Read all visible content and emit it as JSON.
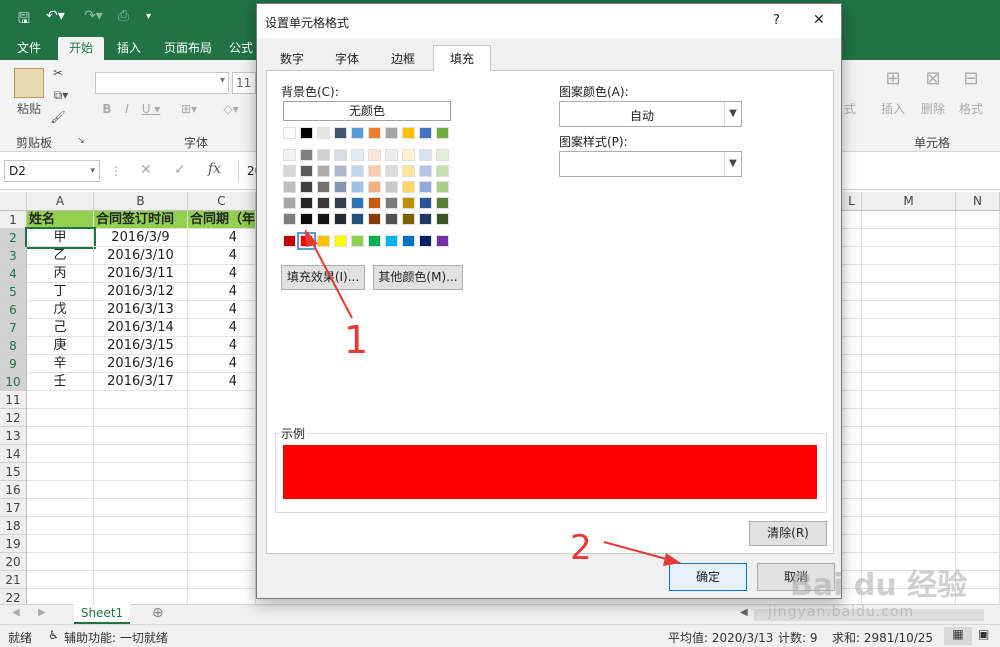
{
  "colors": {
    "excel_green": "#217346",
    "header_fill": "#92d050",
    "sample_red": "#ff0000",
    "annotation_red": "#e53935"
  },
  "excel": {
    "ribbon_tabs": [
      "文件",
      "开始",
      "插入",
      "页面布局",
      "公式"
    ],
    "active_tab": "开始",
    "groups": {
      "clipboard": "剪贴板",
      "font": "字体",
      "cells": "单元格"
    },
    "clipboard": {
      "paste": "粘贴"
    },
    "font_size_partial": "11",
    "cells_buttons": {
      "insert": "插入",
      "delete": "删除",
      "format": "格式",
      "styles_partial": "式"
    },
    "name_box": "D2",
    "formula_icon": "fx",
    "formula_partial": "20",
    "col_headers": [
      "A",
      "B",
      "C",
      "L",
      "M",
      "N"
    ],
    "rows": [
      "1",
      "2",
      "3",
      "4",
      "5",
      "6",
      "7",
      "8",
      "9",
      "10",
      "11",
      "12",
      "13",
      "14",
      "15",
      "16",
      "17",
      "18",
      "19",
      "20",
      "21",
      "22"
    ],
    "header_row": {
      "a": "姓名",
      "b": "合同签订时间",
      "c": "合同期（年"
    },
    "data": [
      {
        "a": "甲",
        "b": "2016/3/9",
        "c": "4"
      },
      {
        "a": "乙",
        "b": "2016/3/10",
        "c": "4"
      },
      {
        "a": "丙",
        "b": "2016/3/11",
        "c": "4"
      },
      {
        "a": "丁",
        "b": "2016/3/12",
        "c": "4"
      },
      {
        "a": "戊",
        "b": "2016/3/13",
        "c": "4"
      },
      {
        "a": "己",
        "b": "2016/3/14",
        "c": "4"
      },
      {
        "a": "庚",
        "b": "2016/3/15",
        "c": "4"
      },
      {
        "a": "辛",
        "b": "2016/3/16",
        "c": "4"
      },
      {
        "a": "壬",
        "b": "2016/3/17",
        "c": "4"
      }
    ],
    "sheet_tab": "Sheet1",
    "status": {
      "ready": "就绪",
      "accessibility": "辅助功能: 一切就绪",
      "average": "平均值: 2020/3/13",
      "count": "计数: 9",
      "sum": "求和: 2981/10/25"
    }
  },
  "dialog": {
    "title": "设置单元格格式",
    "help": "?",
    "close": "✕",
    "tabs": [
      "数字",
      "字体",
      "边框",
      "填充"
    ],
    "active_tab": "填充",
    "bg_color_label": "背景色(C):",
    "no_color": "无颜色",
    "theme_row": [
      "#ffffff",
      "#000000",
      "#e7e6e6",
      "#44546a",
      "#5b9bd5",
      "#ed7d31",
      "#a5a5a5",
      "#ffc000",
      "#4472c4",
      "#70ad47"
    ],
    "tint_rows": [
      [
        "#f2f2f2",
        "#7f7f7f",
        "#d0cece",
        "#d6dce4",
        "#deebf6",
        "#fbe5d5",
        "#ededed",
        "#fff2cc",
        "#d9e2f3",
        "#e2efd9"
      ],
      [
        "#d8d8d8",
        "#595959",
        "#aeabab",
        "#adb9ca",
        "#bdd7ee",
        "#f7cbac",
        "#dbdbdb",
        "#fee599",
        "#b4c6e7",
        "#c5e0b3"
      ],
      [
        "#bfbfbf",
        "#3f3f3f",
        "#757070",
        "#8496b0",
        "#9dc3e6",
        "#f4b183",
        "#c9c9c9",
        "#ffd965",
        "#8eaadb",
        "#a8d08d"
      ],
      [
        "#a5a5a5",
        "#262626",
        "#3a3838",
        "#323f4f",
        "#2e75b5",
        "#c55a11",
        "#7b7b7b",
        "#bf9000",
        "#2f5496",
        "#538135"
      ],
      [
        "#7f7f7f",
        "#0c0c0c",
        "#171616",
        "#222a35",
        "#1e4e79",
        "#843c0b",
        "#525252",
        "#7f6000",
        "#1f3864",
        "#375623"
      ]
    ],
    "standard_row": [
      "#c00000",
      "#ff0000",
      "#ffc000",
      "#ffff00",
      "#92d050",
      "#00b050",
      "#00b0f0",
      "#0070c0",
      "#002060",
      "#7030a0"
    ],
    "selected_standard_index": 1,
    "fill_effects": "填充效果(I)...",
    "more_colors": "其他颜色(M)...",
    "pattern_color_label": "图案颜色(A):",
    "pattern_color_value": "自动",
    "pattern_style_label": "图案样式(P):",
    "sample_label": "示例",
    "sample_color": "#ff0000",
    "clear": "清除(R)",
    "ok": "确定",
    "cancel_partial": "取消"
  },
  "annotations": {
    "step1": "1",
    "step2": "2"
  },
  "watermark": {
    "brand": "Bai du 经验",
    "url": "jingyan.baidu.com"
  }
}
